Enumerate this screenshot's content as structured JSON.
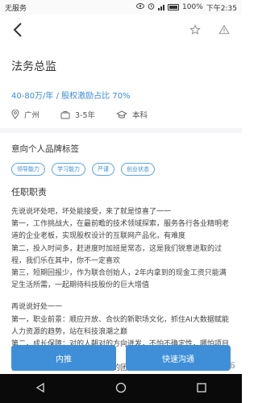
{
  "status_bar": {
    "carrier": "无服务",
    "battery": "100%",
    "time": "下午2:35"
  },
  "job": {
    "title": "法务总监",
    "salary_line": "40-80万/年 / 股权激励占比 70%",
    "location": "广州",
    "experience": "3-5年",
    "education": "本科"
  },
  "brand_tags": {
    "title": "意向个人品牌标签",
    "items": [
      "领导能力",
      "学习能力",
      "严谨",
      "创业状态"
    ]
  },
  "responsibilities": {
    "title": "任职职责",
    "lines": [
      "先说说坏处吧，坏处能接受，来了就是惊喜了一一",
      "第一，工作挑战大，在最前瞻的技术领域探索，服务各行各业精明老道的企业老板，实现股权设计的互联网产品化，有难度",
      "第二，投入时间多，赶进度时加班是常态，这是我们锐意进取的过程，我们乐在其中，你不一定喜欢",
      "第三，短期回报少，作为联合创始人，2年内拿到的现金工资只能满足生活所需，一起期待科技股份的巨大增值",
      "",
      "再说说好处一一",
      "第一，职业前景：顺应开放、合伙的新职场文化，抓住AI大数据赋能人力资源的趋势，站在科技浪潮之巅",
      "第二，成长保障：对的人朝对的方向迸发，不怕不确定性，哪怕项目倒下，也为下一份工作加分加薪",
      "第三，开心体验：源于老企各模的团队，志同道合的"
    ]
  },
  "actions": {
    "refer": "内推",
    "chat": "快速沟通"
  },
  "watermark": "pc6"
}
